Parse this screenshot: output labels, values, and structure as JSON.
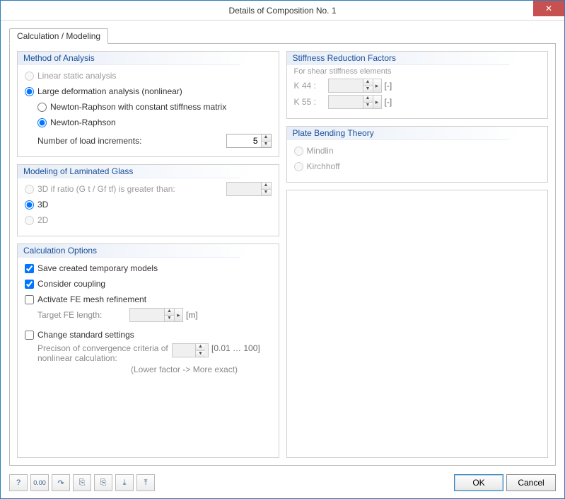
{
  "window": {
    "title": "Details of Composition No. 1",
    "close_glyph": "✕"
  },
  "tab": {
    "label": "Calculation / Modeling"
  },
  "method": {
    "title": "Method of Analysis",
    "linear": "Linear static analysis",
    "large_def": "Large deformation analysis (nonlinear)",
    "nr_const": "Newton-Raphson with constant stiffness matrix",
    "nr": "Newton-Raphson",
    "increments_label": "Number of load increments:",
    "increments_value": "5"
  },
  "laminated": {
    "title": "Modeling of Laminated Glass",
    "ratio": "3D if ratio (G t / Gf tf) is greater than:",
    "opt3d": "3D",
    "opt2d": "2D"
  },
  "calc": {
    "title": "Calculation Options",
    "save_temp": "Save created temporary models",
    "coupling": "Consider coupling",
    "refine": "Activate FE mesh refinement",
    "target_fe": "Target FE length:",
    "target_fe_unit": "[m]",
    "change_std": "Change standard settings",
    "precision_label": "Precison of convergence criteria of nonlinear calculation:",
    "precision_range": "[0.01 … 100]",
    "precision_hint": "(Lower factor -> More exact)"
  },
  "stiffness": {
    "title": "Stiffness Reduction Factors",
    "subtitle": "For shear stiffness elements",
    "k44": "K 44 :",
    "k55": "K 55 :",
    "unit": "[-]"
  },
  "plate": {
    "title": "Plate Bending Theory",
    "mindlin": "Mindlin",
    "kirchhoff": "Kirchhoff"
  },
  "footer": {
    "ok": "OK",
    "cancel": "Cancel",
    "icons": {
      "help": "?",
      "zero": "0.00",
      "curve": "↷",
      "copy1": "⎘",
      "copy2": "⎘",
      "import": "⤓",
      "export": "⤒"
    }
  }
}
